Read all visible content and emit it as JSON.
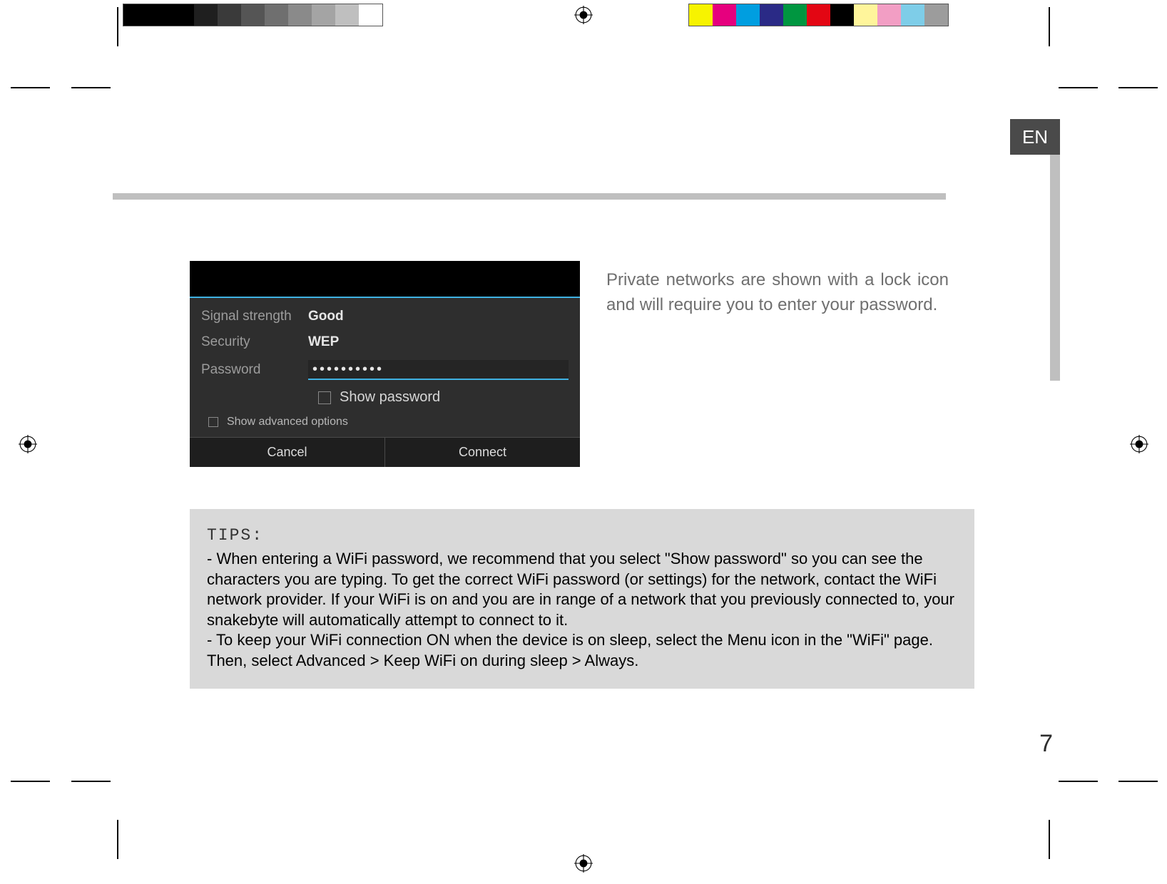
{
  "lang_tab": "EN",
  "page_number": "7",
  "body_paragraph": "Private networks are shown with a lock icon and will require you to enter your password.",
  "wifi": {
    "signal_label": "Signal strength",
    "signal_value": "Good",
    "security_label": "Security",
    "security_value": "WEP",
    "password_label": "Password",
    "password_value": "••••••••••",
    "show_password": "Show password",
    "show_advanced": "Show advanced options",
    "cancel": "Cancel",
    "connect": "Connect"
  },
  "tips": {
    "heading": "TIPS:",
    "item1": "-   When entering a WiFi password, we recommend that you select \"Show password\" so you can see the characters you are typing. To get the correct WiFi password (or settings) for the network, contact the WiFi network provider. If your WiFi is on and you are in range of a network that you previously connected to, your snakebyte will automatically attempt to connect to it.",
    "item2": "-   To keep your WiFi connection ON when the device is on sleep, select the Menu icon in the \"WiFi\" page. Then, select Advanced > Keep WiFi on during sleep > Always."
  },
  "colorbar_left": [
    "#000000",
    "#000000",
    "#000000",
    "#1f1f1f",
    "#3a3a3a",
    "#555555",
    "#6f6f6f",
    "#8a8a8a",
    "#a4a4a4",
    "#bfbfbf",
    "#ffffff"
  ],
  "colorbar_right": [
    "#f7f300",
    "#e6007e",
    "#009ee0",
    "#2a2a86",
    "#009640",
    "#e30613",
    "#000000",
    "#fff59b",
    "#f29ec4",
    "#7ecde8",
    "#9c9c9c"
  ]
}
